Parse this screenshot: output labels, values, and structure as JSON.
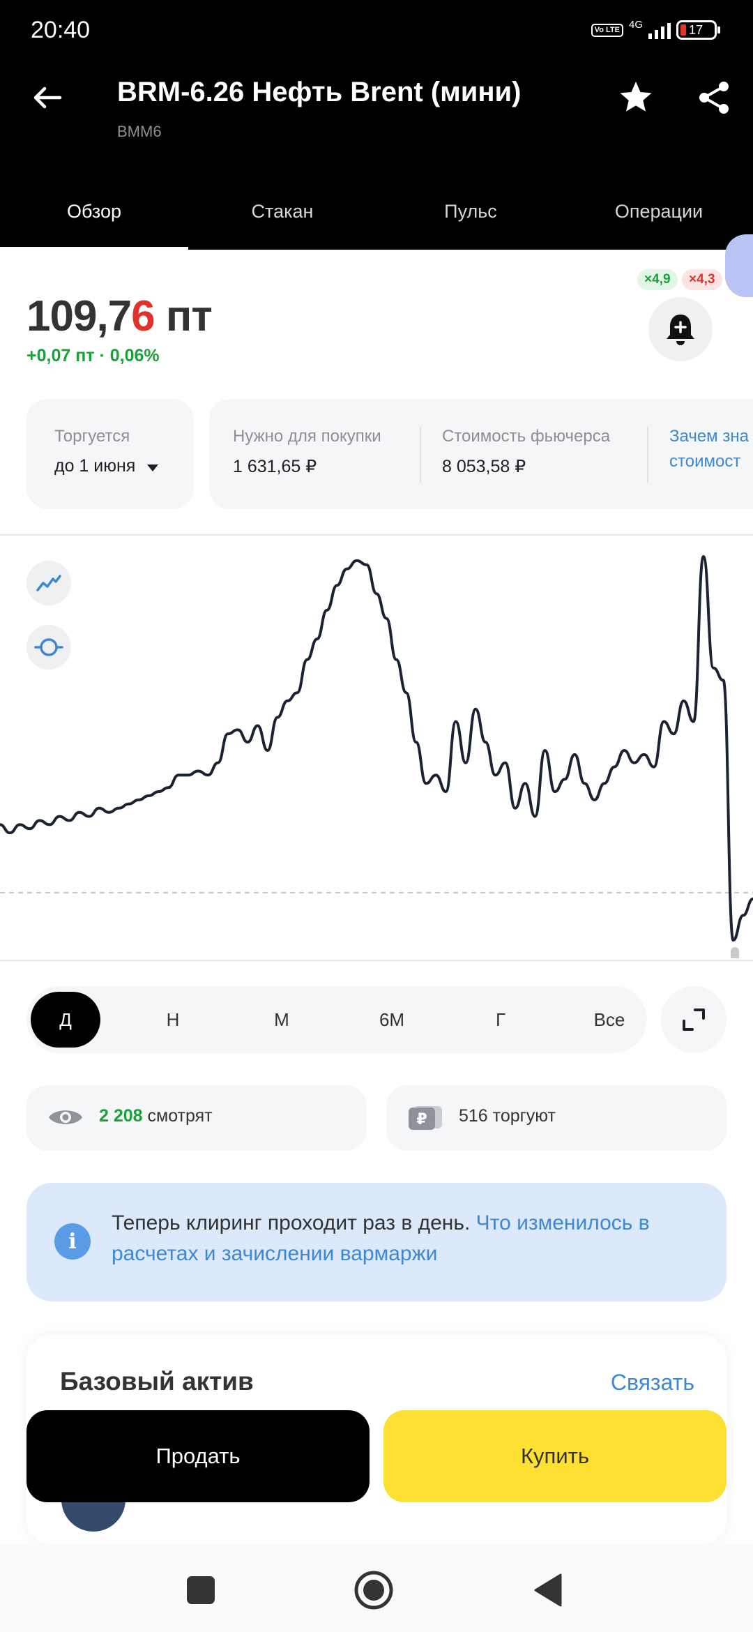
{
  "status_bar": {
    "time": "20:40",
    "network": "4G",
    "volte": "Vo LTE",
    "battery": "17"
  },
  "header": {
    "title": "BRM-6.26 Нефть Brent (мини)",
    "ticker": "BMM6",
    "icons": [
      "back-arrow-icon",
      "star-icon",
      "share-icon"
    ]
  },
  "tabs": [
    {
      "label": "Обзор",
      "active": true
    },
    {
      "label": "Стакан",
      "active": false
    },
    {
      "label": "Пульс",
      "active": false
    },
    {
      "label": "Операции",
      "active": false
    }
  ],
  "price": {
    "main": "109,7",
    "last_digit": "6",
    "unit": " пт",
    "change": "+0,07 пт · 0,06%"
  },
  "leverage": {
    "long": "×4,9",
    "short": "×4,3"
  },
  "trading": {
    "label": "Торгуется",
    "value": "до 1 июня"
  },
  "info": {
    "buy_label": "Нужно для покупки",
    "buy_value": "1 631,65 ₽",
    "cost_label": "Стоимость фьючерса",
    "cost_value": "8 053,58 ₽",
    "why_line1": "Зачем зна",
    "why_line2": "стоимост"
  },
  "chart_data": {
    "type": "line",
    "series": [
      {
        "values": [
          30,
          28,
          30,
          29,
          31,
          30,
          32,
          31,
          33,
          32,
          34,
          33,
          34,
          35,
          36,
          37,
          38,
          39,
          42,
          42,
          43,
          42,
          45,
          52,
          53,
          50,
          54,
          48,
          56,
          60,
          62,
          70,
          75,
          82,
          88,
          92,
          94,
          93,
          86,
          80,
          70,
          62,
          50,
          40,
          42,
          38,
          55,
          45,
          58,
          50,
          42,
          45,
          34,
          40,
          32,
          48,
          38,
          41,
          47,
          40,
          36,
          40,
          44,
          48,
          45,
          47,
          44,
          55,
          52,
          60,
          55,
          95,
          68,
          65,
          2,
          8,
          12
        ]
      }
    ],
    "reference_line": "dashed",
    "grid": false
  },
  "chart_tools": [
    "line-chart-icon",
    "crosshair-icon"
  ],
  "periods": [
    {
      "label": "Д",
      "active": true
    },
    {
      "label": "Н",
      "active": false
    },
    {
      "label": "М",
      "active": false
    },
    {
      "label": "6М",
      "active": false
    },
    {
      "label": "Г",
      "active": false
    },
    {
      "label": "Все",
      "active": false
    }
  ],
  "stats": {
    "watching_count": "2 208",
    "watching_label": " смотрят",
    "trading_count": "516",
    "trading_label": " торгуют"
  },
  "notice": {
    "text": "Теперь клиринг проходит раз в день. ",
    "link": "Что изменилось в расчетах и зачислении вармаржи"
  },
  "asset": {
    "title": "Базовый актив",
    "link": "Связать"
  },
  "actions": {
    "sell": "Продать",
    "buy": "Купить"
  },
  "colors": {
    "accent_yellow": "#fde031",
    "positive": "#1aa13a",
    "negative": "#e0312b",
    "link": "#3e87d3"
  }
}
